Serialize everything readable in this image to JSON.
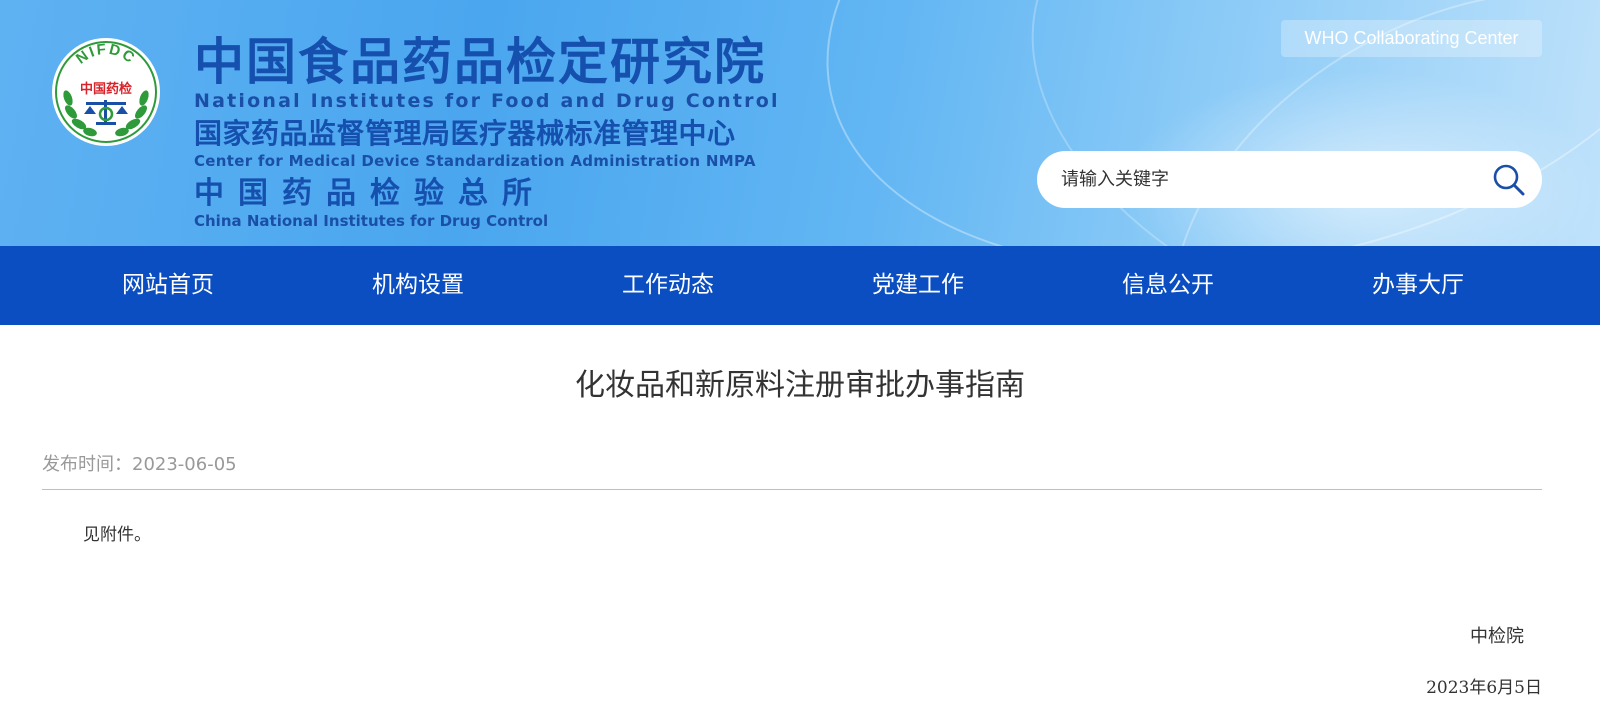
{
  "header": {
    "logo_text": "NIFDC",
    "logo_subtext": "中国药检",
    "title_cn": "中国食品药品检定研究院",
    "title_en": "National Institutes for Food and Drug Control",
    "subtitle_cn": "国家药品监督管理局医疗器械标准管理中心",
    "subtitle_en": "Center for Medical Device Standardization Administration NMPA",
    "third_cn": "中国药品检验总所",
    "third_en": "China National Institutes for Drug Control",
    "who_label": "WHO Collaborating Center",
    "search_placeholder": "请输入关键字",
    "icons": {
      "search": "search-icon",
      "logo": "nifdc-logo"
    }
  },
  "nav": {
    "items": [
      {
        "label": "网站首页"
      },
      {
        "label": "机构设置"
      },
      {
        "label": "工作动态"
      },
      {
        "label": "党建工作"
      },
      {
        "label": "信息公开"
      },
      {
        "label": "办事大厅"
      }
    ]
  },
  "article": {
    "title": "化妆品和新原料注册审批办事指南",
    "publish_label": "发布时间：",
    "publish_date": "2023-06-05",
    "body": "见附件。",
    "signature_org": "中检院",
    "signature_date": "2023年6月5日"
  },
  "colors": {
    "nav_bg": "#0a4ec2",
    "title_blue": "#1650ae",
    "header_bg": "#4aa6ef",
    "logo_green": "#2f9a3a",
    "logo_red": "#d8232a"
  }
}
